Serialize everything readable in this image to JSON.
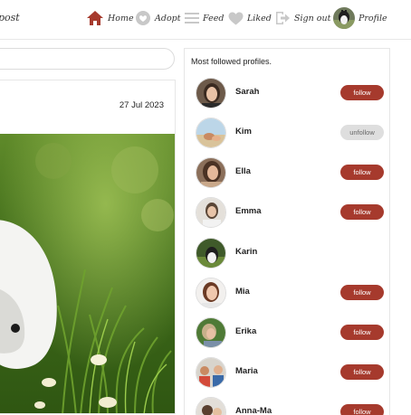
{
  "header": {
    "brand_fragment": "post",
    "nav": [
      {
        "label": "Home",
        "icon": "home-icon",
        "color": "#a63a2d"
      },
      {
        "label": "Adopt",
        "icon": "adopt-icon",
        "color": "#c8c8c8"
      },
      {
        "label": "Feed",
        "icon": "feed-icon",
        "color": "#c8c8c8"
      },
      {
        "label": "Liked",
        "icon": "heart-icon",
        "color": "#c8c8c8"
      },
      {
        "label": "Sign out",
        "icon": "sign-out-icon",
        "color": "#c8c8c8"
      },
      {
        "label": "Profile",
        "icon": "profile-avatar",
        "color": "#555555"
      }
    ]
  },
  "search": {
    "placeholder": ""
  },
  "post": {
    "date": "27 Jul 2023",
    "image": "dog-in-grass-photo"
  },
  "sidebar": {
    "title": "Most followed profiles.",
    "profiles": [
      {
        "name": "Sarah",
        "button": "follow"
      },
      {
        "name": "Kim",
        "button": "unfollow"
      },
      {
        "name": "Ella",
        "button": "follow"
      },
      {
        "name": "Emma",
        "button": "follow"
      },
      {
        "name": "Karin",
        "button": ""
      },
      {
        "name": "Mia",
        "button": "follow"
      },
      {
        "name": "Erika",
        "button": "follow"
      },
      {
        "name": "Maria",
        "button": "follow"
      },
      {
        "name": "Anna-Ma",
        "button": "follow"
      }
    ]
  },
  "colors": {
    "accent": "#a63a2d",
    "unfollow_bg": "#dedede",
    "border": "#e6e6e6"
  }
}
